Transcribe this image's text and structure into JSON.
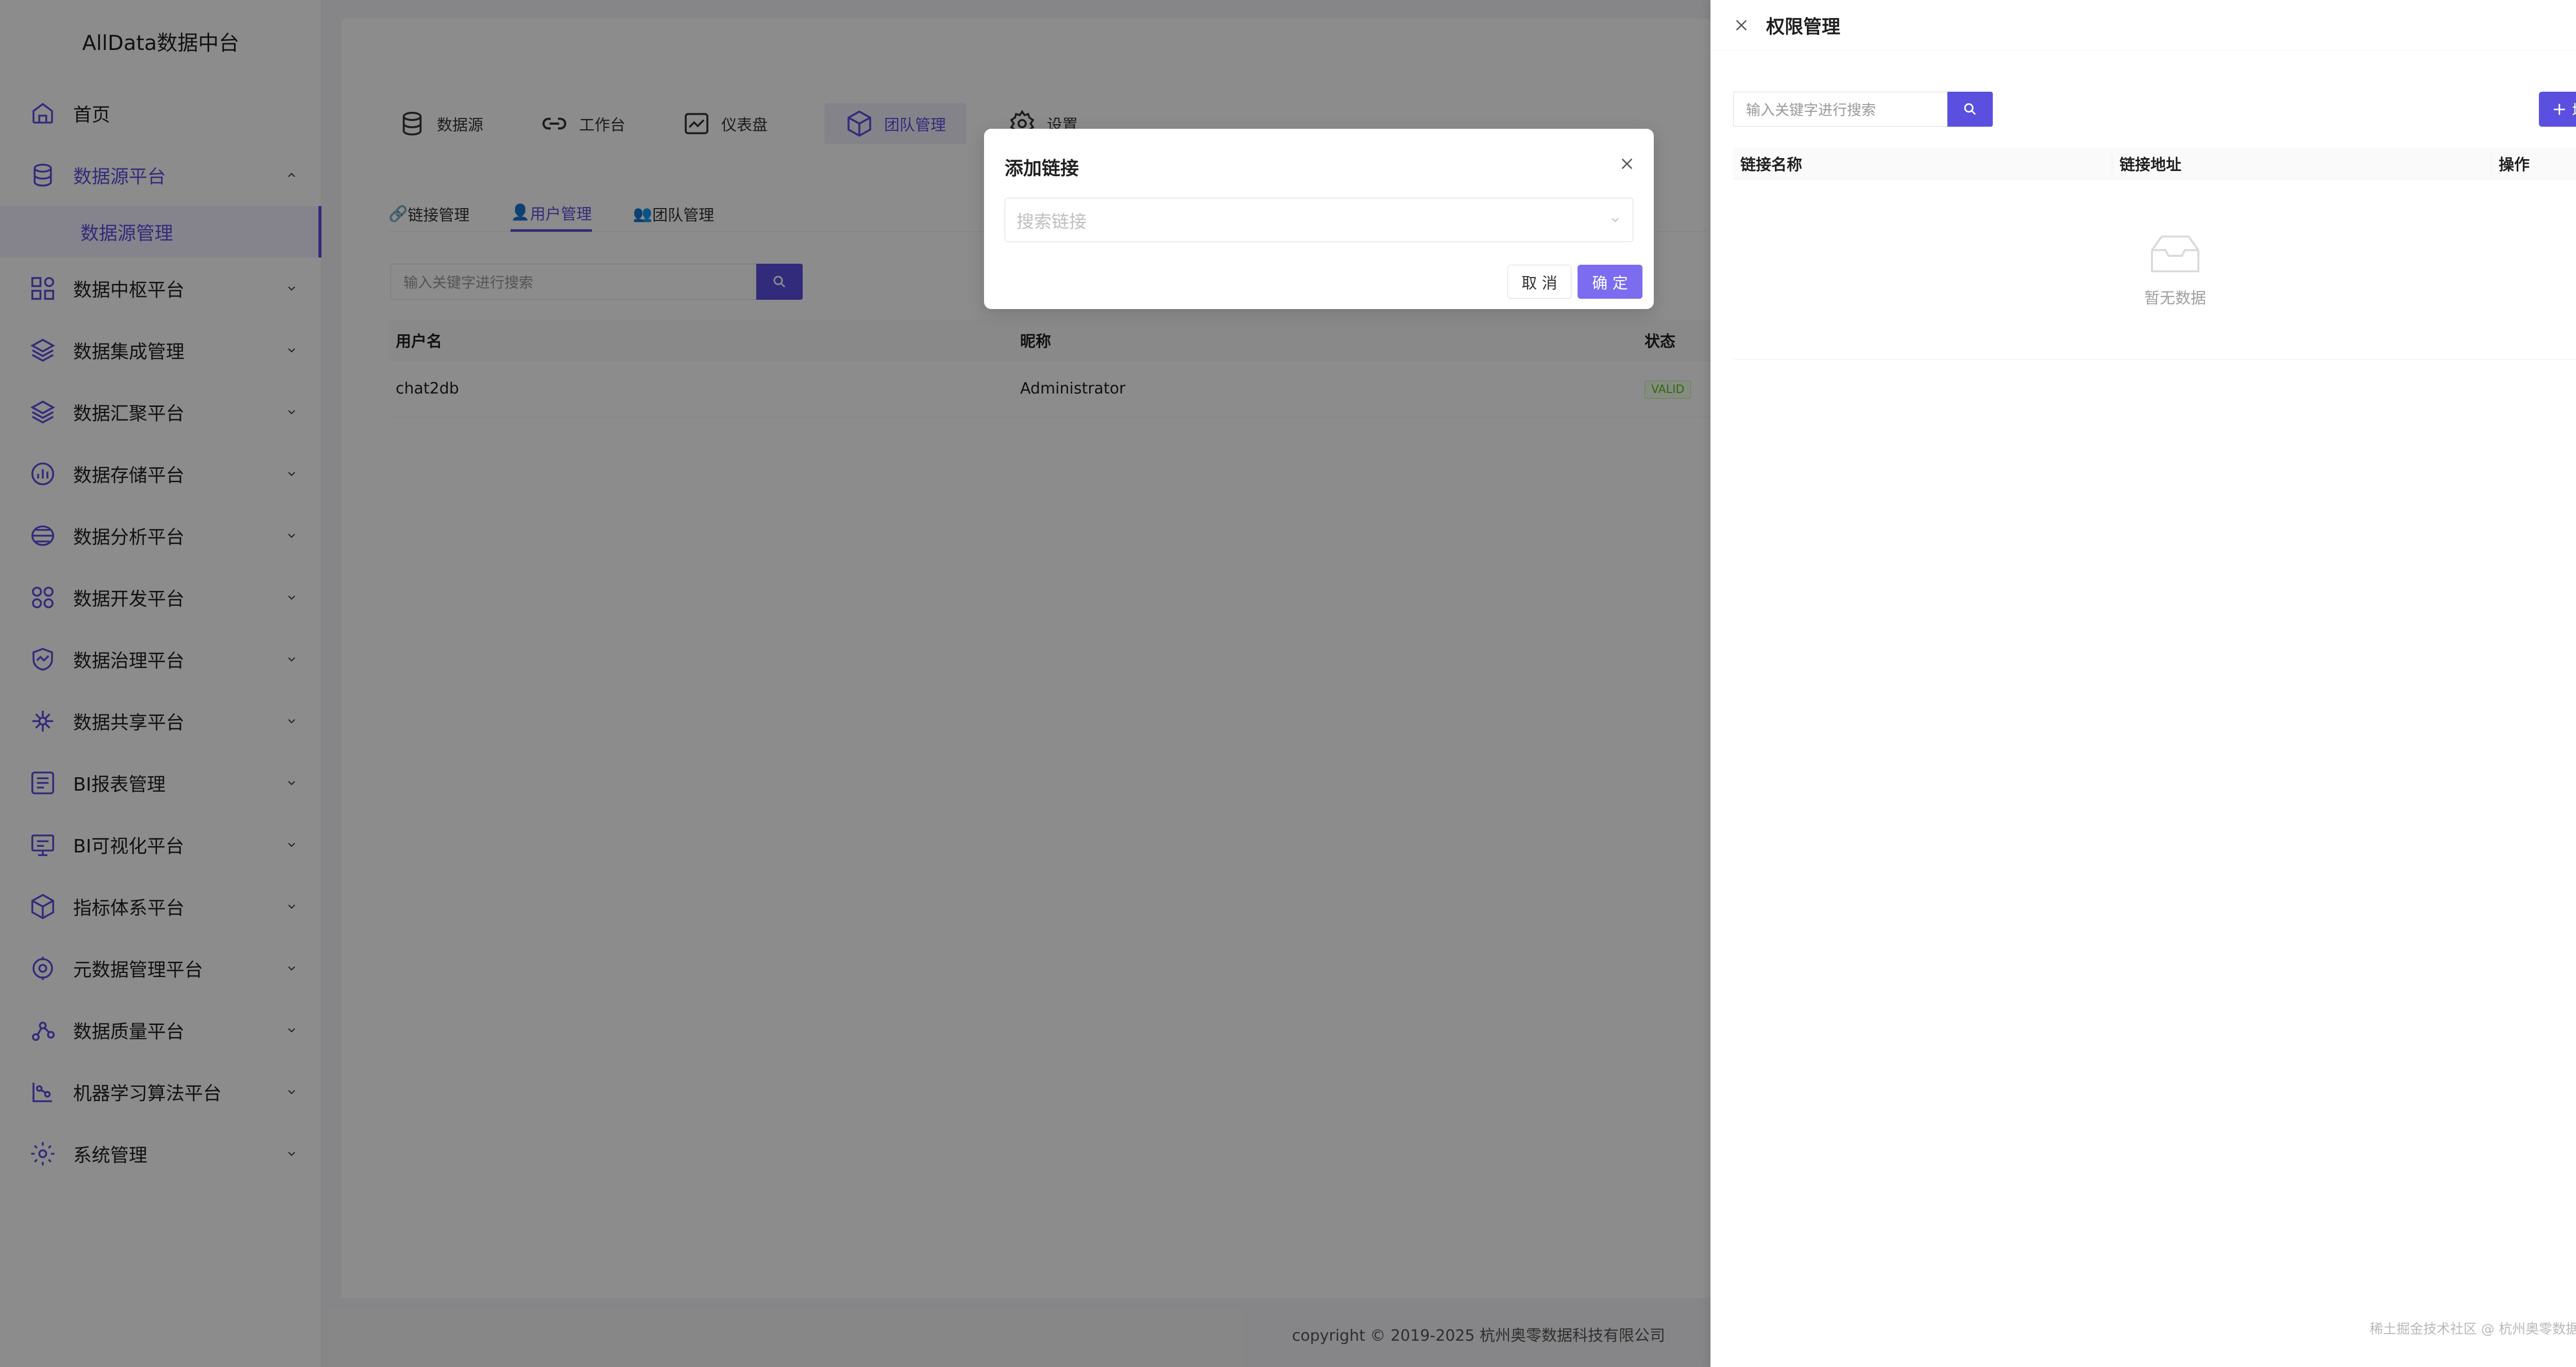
{
  "brand": {
    "title": "AllData数据中台"
  },
  "sidebar": {
    "items": [
      {
        "label": "首页",
        "icon": "home-icon"
      },
      {
        "label": "数据源平台",
        "icon": "database-stack-icon",
        "active": true,
        "expanded": true
      },
      {
        "label": "数据中枢平台",
        "icon": "grid-icon"
      },
      {
        "label": "数据集成管理",
        "icon": "layers-icon"
      },
      {
        "label": "数据汇聚平台",
        "icon": "layers-icon"
      },
      {
        "label": "数据存储平台",
        "icon": "storage-icon"
      },
      {
        "label": "数据分析平台",
        "icon": "analysis-icon"
      },
      {
        "label": "数据开发平台",
        "icon": "apps-icon"
      },
      {
        "label": "数据治理平台",
        "icon": "shield-icon"
      },
      {
        "label": "数据共享平台",
        "icon": "share-icon"
      },
      {
        "label": "BI报表管理",
        "icon": "report-icon"
      },
      {
        "label": "BI可视化平台",
        "icon": "monitor-icon"
      },
      {
        "label": "指标体系平台",
        "icon": "cube-icon"
      },
      {
        "label": "元数据管理平台",
        "icon": "metadata-icon"
      },
      {
        "label": "数据质量平台",
        "icon": "quality-icon"
      },
      {
        "label": "机器学习算法平台",
        "icon": "ml-icon"
      },
      {
        "label": "系统管理",
        "icon": "settings-icon"
      }
    ],
    "sub_item": {
      "label": "数据源管理"
    }
  },
  "top_tabs": [
    {
      "label": "数据源",
      "icon": "database-icon"
    },
    {
      "label": "工作台",
      "icon": "link-icon"
    },
    {
      "label": "仪表盘",
      "icon": "dashboard-icon"
    },
    {
      "label": "团队管理",
      "icon": "cube-icon",
      "active": true
    },
    {
      "label": "设置",
      "icon": "gear-icon"
    }
  ],
  "sub_tabs": [
    {
      "label": "链接管理"
    },
    {
      "label": "用户管理",
      "active": true
    },
    {
      "label": "团队管理"
    }
  ],
  "user_search": {
    "placeholder": "输入关键字进行搜索"
  },
  "user_table": {
    "columns": [
      "用户名",
      "昵称",
      "状态"
    ],
    "rows": [
      {
        "username": "chat2db",
        "nickname": "Administrator",
        "status": "VALID"
      }
    ]
  },
  "footer": {
    "copyright": "copyright © 2019-2025 杭州奥零数据科技有限公司"
  },
  "drawer": {
    "title": "权限管理",
    "search_placeholder": "输入关键字进行搜索",
    "add_label": "增加",
    "columns": [
      "链接名称",
      "链接地址",
      "操作"
    ],
    "empty_text": "暂无数据",
    "watermark": "稀土掘金技术社区 @ 杭州奥零数据科技"
  },
  "modal": {
    "title": "添加链接",
    "select_placeholder": "搜索链接",
    "cancel_label": "取 消",
    "ok_label": "确 定"
  },
  "colors": {
    "accent": "#5b4fe0",
    "ok_button": "#7b6cf0",
    "valid": "#52c41a"
  }
}
